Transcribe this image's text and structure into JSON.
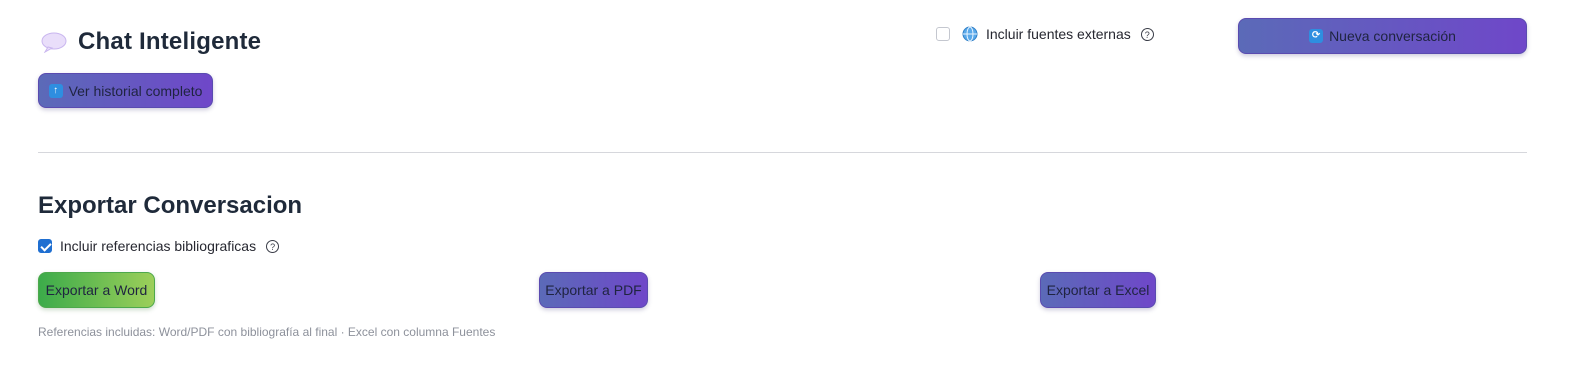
{
  "header": {
    "title": "Chat Inteligente",
    "title_icon": "speech-bubble-icon",
    "history_button": {
      "icon": "up-arrow-icon",
      "label": "Ver historial completo"
    },
    "external_sources": {
      "label": "Incluir fuentes externas",
      "checked": false,
      "icon": "globe-icon"
    },
    "new_chat_button": {
      "icon": "refresh-icon",
      "label": "Nueva conversación"
    }
  },
  "export": {
    "title": "Exportar Conversacion",
    "include_refs": {
      "label": "Incluir referencias bibliograficas",
      "checked": true
    },
    "buttons": {
      "word": "Exportar a Word",
      "pdf": "Exportar a PDF",
      "excel": "Exportar a Excel"
    },
    "footnote": "Referencias incluidas: Word/PDF con bibliografía al final · Excel con columna Fuentes"
  },
  "colors": {
    "accent_gradient_start": "#5b6ab8",
    "accent_gradient_end": "#6f47c9",
    "word_gradient_start": "#3cab4a",
    "word_gradient_end": "#9ccf5a",
    "checkbox_checked": "#1f6fd1"
  }
}
